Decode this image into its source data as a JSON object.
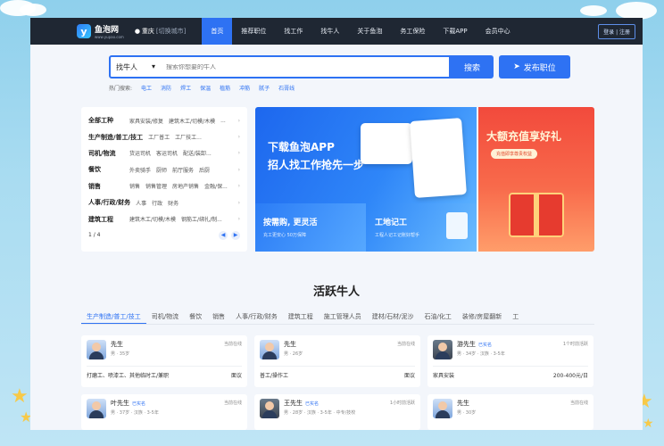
{
  "colors": {
    "accent": "#2e72f3",
    "nav_bg": "#1f2733",
    "promo_red": "#f24a3c"
  },
  "nav": {
    "logo_text": "鱼泡网",
    "logo_sub": "www.yupao.com",
    "city": "重庆",
    "city_switch": "[切换城市]",
    "items": [
      {
        "label": "首页"
      },
      {
        "label": "推荐职位"
      },
      {
        "label": "找工作"
      },
      {
        "label": "找牛人"
      },
      {
        "label": "关于鱼泡"
      },
      {
        "label": "务工保险"
      },
      {
        "label": "下载APP"
      },
      {
        "label": "会员中心"
      }
    ],
    "login": "登录 | 注册"
  },
  "search": {
    "type_label": "找牛人",
    "placeholder": "搜索你想要的牛人",
    "button": "搜索",
    "post_button": "发布职位",
    "hot_label": "热门搜索:",
    "hot_terms": [
      "电工",
      "消防",
      "焊工",
      "保温",
      "植筋",
      "冲筋",
      "腻子",
      "石膏线"
    ]
  },
  "categories": {
    "rows": [
      {
        "main": "全部工种",
        "subs": [
          "家具安装/修复",
          "建筑木工/切模/木模",
          "..."
        ]
      },
      {
        "main": "生产制造/普工/技工",
        "subs": [
          "工厂普工",
          "工厂技工..."
        ]
      },
      {
        "main": "司机/物流",
        "subs": [
          "货运司机",
          "客运司机",
          "配送/装卸..."
        ]
      },
      {
        "main": "餐饮",
        "subs": [
          "外卖骑手",
          "厨师",
          "前厅服务",
          "后厨"
        ]
      },
      {
        "main": "销售",
        "subs": [
          "销售",
          "销售管理",
          "房地产销售",
          "金融/保..."
        ]
      },
      {
        "main": "人事/行政/财务",
        "subs": [
          "人事",
          "行政",
          "财务"
        ]
      },
      {
        "main": "建筑工程",
        "subs": [
          "建筑木工/切模/木模",
          "钢筋工/绑扎/制..."
        ]
      }
    ],
    "page": "1 / 4"
  },
  "banners": {
    "main_line1": "下载鱼泡APP",
    "main_line2": "招人找工作抢先一步",
    "small1_title": "按需购, 更灵活",
    "small1_sub": "充工更安心 50万保障",
    "small2_title": "工地记工",
    "small2_sub": "工程人记工记账好帮手",
    "red_title": "大额充值享好礼",
    "red_pill": "充值即享尊贵权益"
  },
  "talent": {
    "title": "活跃牛人",
    "tabs": [
      "生产制造/普工/技工",
      "司机/物流",
      "餐饮",
      "销售",
      "人事/行政/财务",
      "建筑工程",
      "施工管理人员",
      "建材/石材/泥沙",
      "石油/化工",
      "装修/房屋翻新",
      "工"
    ],
    "cards": [
      {
        "name": "先生",
        "badge": "",
        "status": "当前在线",
        "meta": "男 · 35岁",
        "job": "打磨工、喷漆工、其他临时工/兼职",
        "salary": "面议",
        "photo": false
      },
      {
        "name": "先生",
        "badge": "",
        "status": "当前在线",
        "meta": "男 · 26岁",
        "job": "普工/操作工",
        "salary": "面议",
        "photo": false
      },
      {
        "name": "游先生",
        "badge": "已实名",
        "status": "1个时前活跃",
        "meta": "男 · 34岁 · 汉族 · 3-5年",
        "job": "家具安装",
        "salary": "200-400元/日",
        "photo": true
      },
      {
        "name": "叶先生",
        "badge": "已实名",
        "status": "当前在线",
        "meta": "男 · 37岁 · 汉族 · 3-5年",
        "job": "",
        "salary": "",
        "photo": false
      },
      {
        "name": "王先生",
        "badge": "已实名",
        "status": "1小时前活跃",
        "meta": "男 · 28岁 · 汉族 · 3-5年 · 中专/技校",
        "job": "",
        "salary": "",
        "photo": true
      },
      {
        "name": "先生",
        "badge": "",
        "status": "当前在线",
        "meta": "男 · 30岁",
        "job": "",
        "salary": "",
        "photo": false
      }
    ]
  }
}
